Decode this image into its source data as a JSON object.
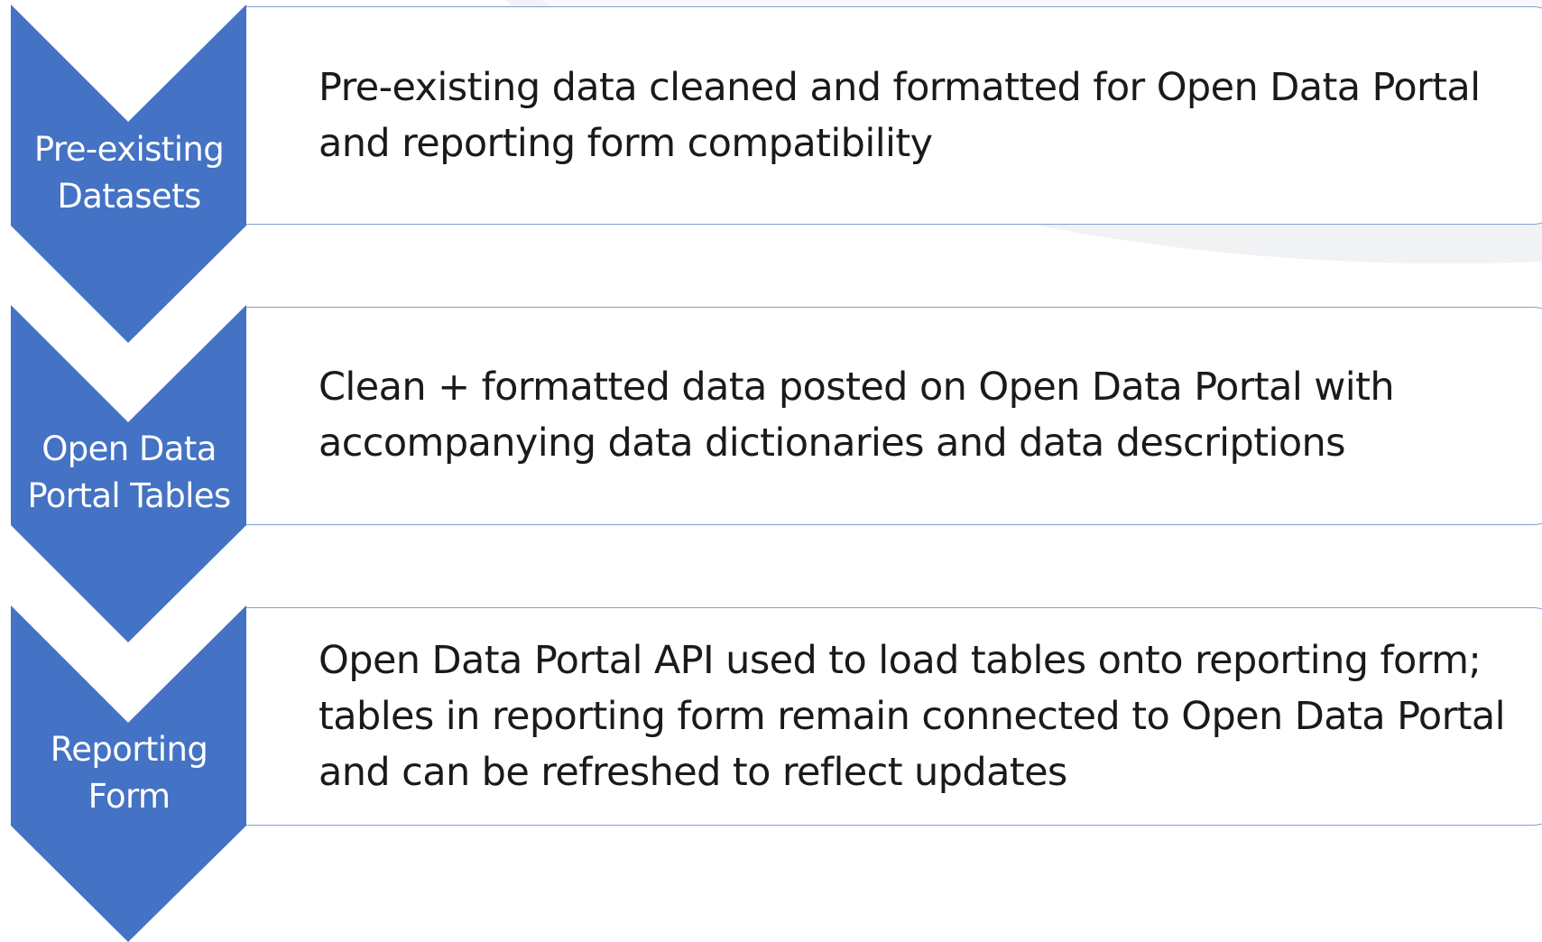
{
  "colors": {
    "arrow_fill": "#4472c4",
    "box_border": "#7f9fd6",
    "text": "#1a1a1a",
    "label_text": "#ffffff"
  },
  "steps": [
    {
      "label_line1": "Pre-existing",
      "label_line2": "Datasets",
      "description": "Pre-existing data cleaned and formatted for Open Data Portal and reporting form compatibility"
    },
    {
      "label_line1": "Open Data",
      "label_line2": "Portal Tables",
      "description": "Clean + formatted data posted on Open Data Portal with accompanying data dictionaries and data descriptions"
    },
    {
      "label_line1": "Reporting",
      "label_line2": "Form",
      "description": "Open Data Portal API used to load tables onto reporting form; tables in reporting form remain connected to Open Data Portal and can be refreshed to reflect updates"
    }
  ]
}
